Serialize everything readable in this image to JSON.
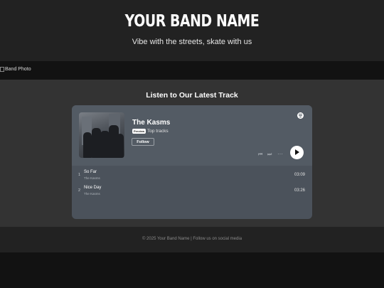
{
  "header": {
    "band_name": "YOUR BAND NAME",
    "tagline": "Vibe with the streets, skate with us"
  },
  "photo": {
    "alt_text": "Band Photo"
  },
  "section": {
    "title": "Listen to Our Latest Track"
  },
  "player": {
    "title": "The Kasms",
    "preview_badge": "Preview",
    "subtitle": "Top tracks",
    "follow_label": "Follow",
    "icons": {
      "brand": "spotify-icon",
      "previous": "skip-previous-icon",
      "next": "skip-next-icon",
      "more": "more-options-icon",
      "play": "play-icon"
    },
    "tracks": [
      {
        "number": "1",
        "title": "So Far",
        "artist": "The Kasms",
        "duration": "03:09"
      },
      {
        "number": "2",
        "title": "Nice Day",
        "artist": "The Kasms",
        "duration": "03:26"
      }
    ]
  },
  "footer": {
    "text": "© 2025 Your Band Name | Follow us on social media"
  },
  "colors": {
    "page_bg": "#121212",
    "header_bg": "#222222",
    "main_bg": "#333333",
    "player_bg": "#4b525b",
    "player_top_bg": "#535b64"
  }
}
